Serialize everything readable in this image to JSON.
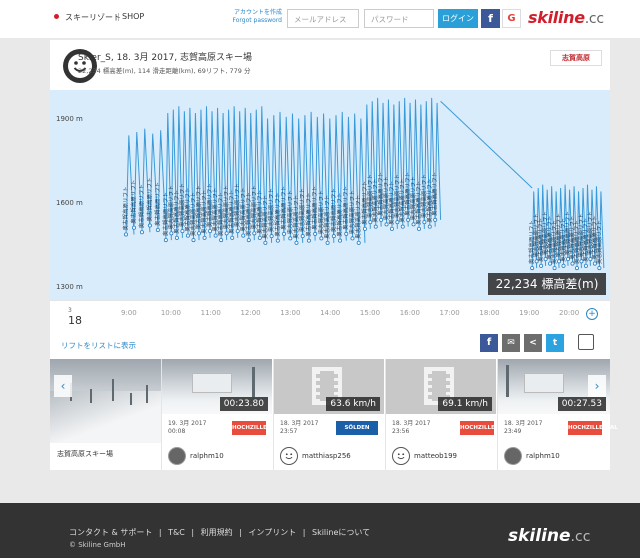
{
  "header": {
    "resort_link": "スキーリゾート",
    "separator": "|",
    "shop_link": "SHOP",
    "forgot_jp": "アカウントを作成",
    "forgot_en": "Forgot password",
    "email_placeholder": "メールアドレス",
    "password_placeholder": "パスワード",
    "login_label": "ログイン",
    "facebook_label": "f",
    "google_label": "G",
    "logo_main": "skiline",
    "logo_cc": ".cc",
    "colors": {
      "brand_red": "#d21e2b",
      "blue": "#2a9fd8",
      "facebook": "#3b5998"
    }
  },
  "ride": {
    "title": "Skier_S, 18. 3月 2017, 志賀高原スキー場",
    "stats": "22,234 標高差(m), 114 滑走距離(km), 69リフト, 779 分",
    "resort_badge": "志賀高原"
  },
  "chart_data": {
    "type": "line",
    "title": "",
    "xlabel": "",
    "ylabel": "",
    "ytick_labels": [
      "1900 m",
      "1600 m",
      "1300 m"
    ],
    "ylim": [
      1250,
      2000
    ],
    "xtick_labels": [
      "9:00",
      "10:00",
      "11:00",
      "12:00",
      "13:00",
      "14:00",
      "15:00",
      "16:00",
      "17:00",
      "18:00",
      "19:00",
      "20:00"
    ],
    "x_hours": [
      9,
      10,
      11,
      12,
      13,
      14,
      15,
      16,
      17,
      18,
      19,
      20
    ],
    "lift_label": "奥志賀高原リフト",
    "total_label": "22,234 標高差(m)",
    "grid": false,
    "series": [
      {
        "hour_range": [
          8.9,
          9.9
        ],
        "lifts": 5,
        "top": 1850,
        "bottom": 1500
      },
      {
        "hour_range": [
          9.9,
          12.4
        ],
        "lifts": 18,
        "top": 1930,
        "bottom": 1480
      },
      {
        "hour_range": [
          12.4,
          14.9
        ],
        "lifts": 16,
        "top": 1910,
        "bottom": 1470
      },
      {
        "hour_range": [
          14.9,
          16.8
        ],
        "lifts": 14,
        "top": 1960,
        "bottom": 1520
      },
      {
        "hour_range": [
          19.1,
          20.9
        ],
        "lifts": 16,
        "top": 1650,
        "bottom": 1380
      }
    ],
    "descent": {
      "from_hour": 16.8,
      "to_hour": 19.1,
      "from": 1960,
      "to": 1650
    },
    "colors": {
      "background": "#d9ecfb",
      "line": "#3a9ad9",
      "dot": "#2a7fc2"
    }
  },
  "timeaxis": {
    "month": "3",
    "day": "18",
    "zoom_label": "+"
  },
  "actions": {
    "list_link": "リフトをリストに表示",
    "facebook": "f",
    "mail": "✉",
    "share": "<",
    "twitter": "t"
  },
  "gallery": {
    "prev_label": "‹",
    "next_label": "›",
    "resort_caption": "志賀高原スキー場",
    "items": [
      {
        "badge": "00:23.80",
        "date": "19. 3月 2017",
        "time": "00:08",
        "ski_badge": "HOCHZILLERTAL",
        "user": "ralphm10"
      },
      {
        "badge": "63.6 km/h",
        "date": "18. 3月 2017",
        "time": "23:57",
        "ski_badge": "SÖLDEN",
        "user": "matthiasp256"
      },
      {
        "badge": "69.1 km/h",
        "date": "18. 3月 2017",
        "time": "23:56",
        "ski_badge": "HOCHZILLERTAL",
        "user": "matteob199"
      },
      {
        "badge": "00:27.53",
        "date": "18. 3月 2017",
        "time": "23:49",
        "ski_badge": "HOCHZILLERTAL",
        "user": "ralphm10"
      }
    ]
  },
  "footer": {
    "links": [
      "コンタクト & サポート",
      "|",
      "T&C",
      "|",
      "利用規約",
      "|",
      "インプリント",
      "|",
      "Skilineについて"
    ],
    "copyright": "© Skiline GmbH",
    "logo_main": "skiline",
    "logo_cc": ".cc"
  }
}
